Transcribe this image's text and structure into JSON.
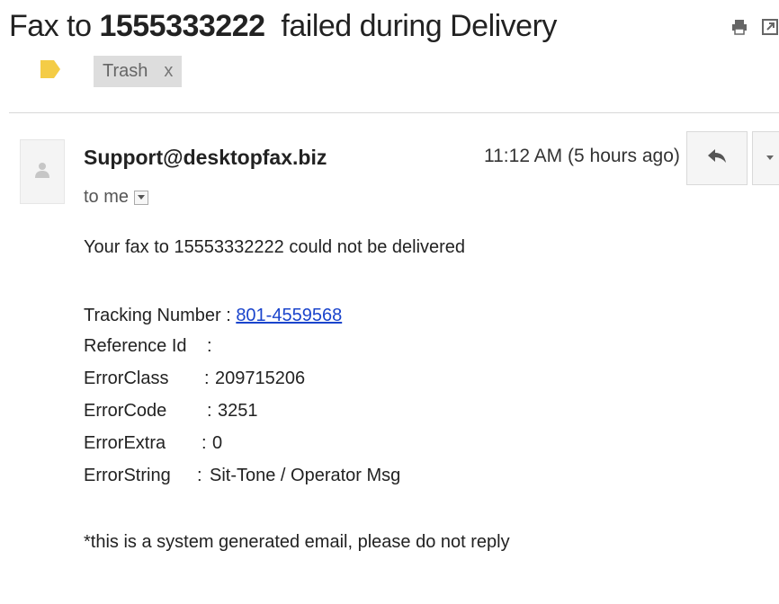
{
  "subject": {
    "prefix": "Fax to ",
    "number": "1555333222",
    "suffix": "  failed during Delivery"
  },
  "labels": {
    "trash": "Trash",
    "remove": "x"
  },
  "icons": {
    "print": "print-icon",
    "new_window": "new-window-icon",
    "label_tag": "label-tag-icon",
    "avatar": "person-icon",
    "reply": "reply-icon",
    "more": "chevron-down-icon",
    "details": "small-dropdown-icon"
  },
  "colors": {
    "label_tag": "#f4cc46",
    "link": "#1a44cc",
    "chip_bg": "#dddddd"
  },
  "message": {
    "sender": "Support@desktopfax.biz",
    "timestamp": "11:12 AM (5 hours ago)",
    "to": "to me",
    "intro": "Your fax to 15553332222 could not be delivered",
    "fields": [
      {
        "key": "Tracking Number",
        "sep": " : ",
        "value": "801-4559568"
      },
      {
        "key": "Reference Id",
        "sep": ":",
        "value": ""
      },
      {
        "key": "ErrorClass",
        "sep": ": ",
        "value": "209715206"
      },
      {
        "key": "ErrorCode",
        "sep": ": ",
        "value": "3251"
      },
      {
        "key": "ErrorExtra",
        "sep": ": ",
        "value": "0"
      },
      {
        "key": "ErrorString",
        "sep": ": ",
        "value": "Sit-Tone / Operator Msg"
      }
    ],
    "footer": "*this is a system generated email, please do not reply"
  }
}
